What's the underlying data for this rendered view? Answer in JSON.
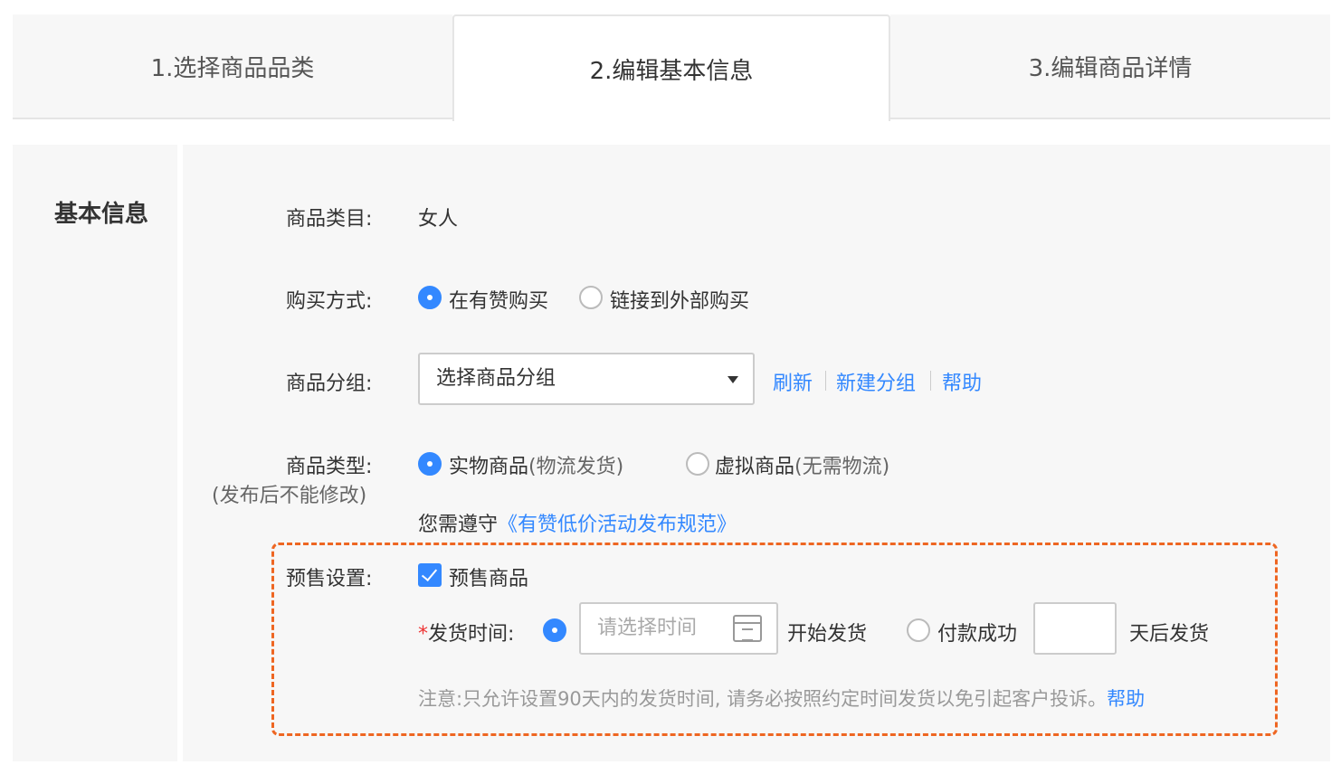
{
  "tabs": [
    {
      "label": "1.选择商品品类"
    },
    {
      "label": "2.编辑基本信息"
    },
    {
      "label": "3.编辑商品详情"
    }
  ],
  "section": {
    "title": "基本信息"
  },
  "category": {
    "label": "商品类目:",
    "value": "女人"
  },
  "purchase": {
    "label": "购买方式:",
    "options": [
      {
        "label": "在有赞购买",
        "selected": true
      },
      {
        "label": "链接到外部购买",
        "selected": false
      }
    ]
  },
  "group": {
    "label": "商品分组:",
    "select_value": "选择商品分组",
    "links": [
      "刷新",
      "新建分组",
      "帮助"
    ]
  },
  "type": {
    "label": "商品类型:",
    "sublabel": "(发布后不能修改)",
    "options": [
      {
        "label": "实物商品",
        "note": "(物流发货)",
        "selected": true
      },
      {
        "label": "虚拟商品",
        "note": "(无需物流)",
        "selected": false
      }
    ],
    "policy_prefix": "您需遵守",
    "policy_link": "《有赞低价活动发布规范》"
  },
  "presale": {
    "label": "预售设置:",
    "checkbox_label": "预售商品",
    "checked": true,
    "ship_time_label": "发货时间:",
    "required_mark": "*",
    "date_placeholder": "请选择时间",
    "start_ship": "开始发货",
    "pay_success": "付款成功",
    "days_after": "天后发货",
    "note": "注意:只允许设置90天内的发货时间, 请务必按照约定时间发货以免引起客户投诉。",
    "help_link": "帮助"
  },
  "colors": {
    "accent": "#3388ff",
    "highlight": "#ee6622",
    "required": "#ee3333"
  }
}
